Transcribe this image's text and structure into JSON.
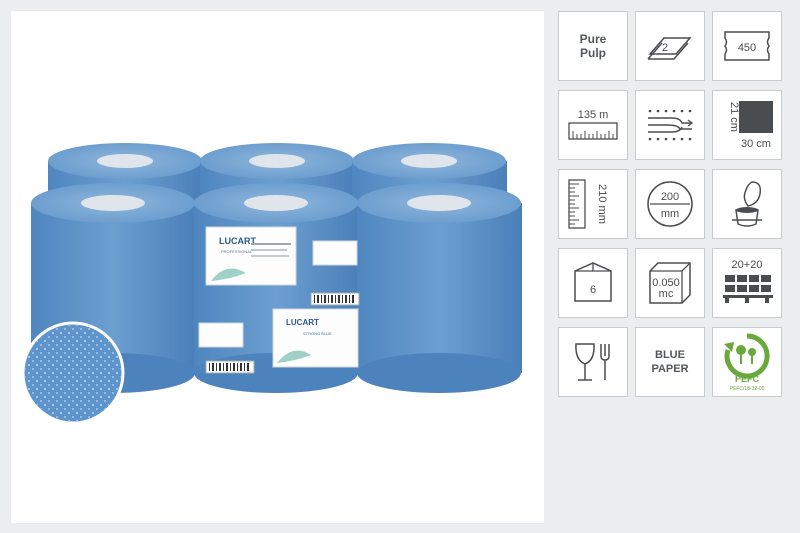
{
  "product_photo": {
    "brand": "LUCART",
    "brand_sub": "PROFESSIONAL",
    "product_line": "STRONG BLUE"
  },
  "features": {
    "pure_pulp": "Pure\nPulp",
    "plies": "2",
    "sheets": "450",
    "length": "135 m",
    "height_label": "21 cm",
    "width_label": "30 cm",
    "diameter_label": "210 mm",
    "core_value": "200",
    "core_unit": "mm",
    "pack_count": "6",
    "volume_value": "0.050",
    "volume_unit": "mc",
    "pallet": "20+20",
    "color": "BLUE\nPAPER",
    "pefc": "PEFC",
    "pefc_code": "PEFC/18-32-05"
  },
  "colors": {
    "roll_blue": "#5b8fc4",
    "icon_grey": "#4a4d50",
    "tile_border": "#c9cccf",
    "pefc_green": "#69a83b"
  }
}
